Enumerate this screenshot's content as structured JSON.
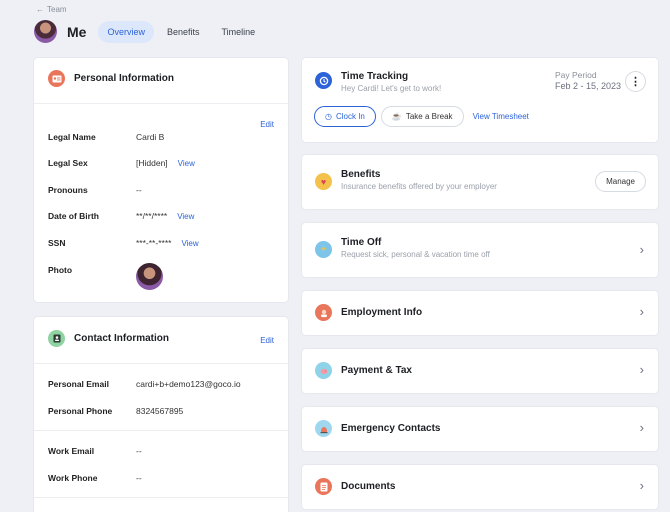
{
  "breadcrumb": {
    "back_label": "Team"
  },
  "header": {
    "title": "Me",
    "tabs": [
      "Overview",
      "Benefits",
      "Timeline"
    ]
  },
  "personal": {
    "title": "Personal Information",
    "edit": "Edit",
    "rows": [
      {
        "label": "Legal Name",
        "value": "Cardi B"
      },
      {
        "label": "Legal Sex",
        "value": "[Hidden]",
        "link": "View"
      },
      {
        "label": "Pronouns",
        "value": "--"
      },
      {
        "label": "Date of Birth",
        "value": "**/**/****",
        "link": "View"
      },
      {
        "label": "SSN",
        "value": "***-**-****",
        "link": "View"
      },
      {
        "label": "Photo",
        "value": ""
      }
    ]
  },
  "contact": {
    "title": "Contact Information",
    "edit": "Edit",
    "rows": [
      {
        "label": "Personal Email",
        "value": "cardi+b+demo123@goco.io"
      },
      {
        "label": "Personal Phone",
        "value": "8324567895"
      },
      {
        "label": "Work Email",
        "value": "--"
      },
      {
        "label": "Work Phone",
        "value": "--"
      }
    ]
  },
  "time_tracking": {
    "title": "Time Tracking",
    "subtitle": "Hey Cardi! Let's get to work!",
    "pay_period_label": "Pay Period",
    "pay_period_value": "Feb 2 - 15, 2023",
    "clock_in": "Clock In",
    "take_break": "Take a Break",
    "view_timesheet": "View Timesheet"
  },
  "benefits": {
    "title": "Benefits",
    "subtitle": "Insurance benefits offered by your employer",
    "manage": "Manage"
  },
  "time_off": {
    "title": "Time Off",
    "subtitle": "Request sick, personal & vacation time off"
  },
  "employment": {
    "title": "Employment Info"
  },
  "payment": {
    "title": "Payment & Tax"
  },
  "emergency": {
    "title": "Emergency Contacts"
  },
  "documents": {
    "title": "Documents"
  },
  "colors": {
    "accent": "#2c63d8",
    "background": "#eef0f5"
  }
}
